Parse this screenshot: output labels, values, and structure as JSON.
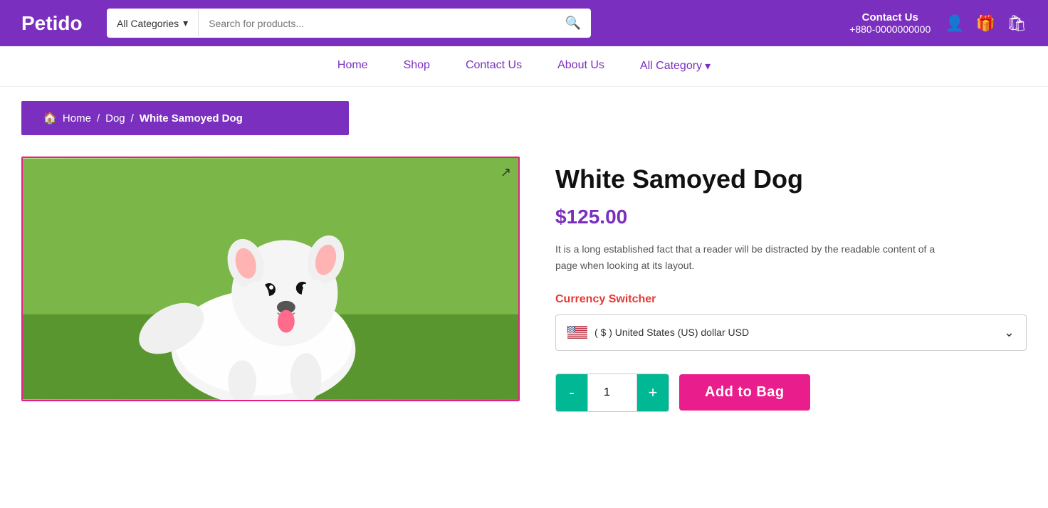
{
  "header": {
    "logo": "Petido",
    "search": {
      "category": "All Categories",
      "placeholder": "Search for products...",
      "category_chevron": "▾"
    },
    "contact": {
      "label": "Contact Us",
      "phone": "+880-0000000000"
    },
    "icons": {
      "user": "👤",
      "gift": "🎁",
      "cart": "🛍"
    }
  },
  "nav": {
    "items": [
      {
        "label": "Home",
        "href": "#"
      },
      {
        "label": "Shop",
        "href": "#"
      },
      {
        "label": "Contact Us",
        "href": "#"
      },
      {
        "label": "About Us",
        "href": "#"
      },
      {
        "label": "All Category",
        "href": "#"
      }
    ],
    "all_cat_chevron": "▾"
  },
  "breadcrumb": {
    "home_icon": "🏠",
    "home_label": "Home",
    "sep1": "/",
    "level1": "Dog",
    "sep2": "/",
    "current": "White Samoyed Dog"
  },
  "product": {
    "title": "White Samoyed Dog",
    "price": "$125.00",
    "description": "It is a long established fact that a reader will be distracted by the readable content of a page when looking at its layout.",
    "currency_label": "Currency Switcher",
    "currency_option": "( $ ) United States (US) dollar USD",
    "quantity": "1",
    "add_to_bag": "Add to Bag",
    "qty_minus": "-",
    "qty_plus": "+"
  }
}
